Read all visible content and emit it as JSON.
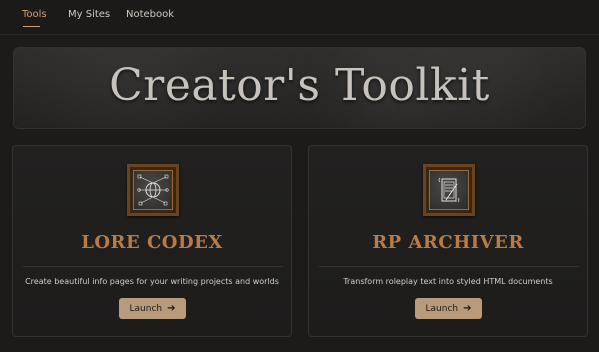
{
  "nav": {
    "items": [
      {
        "label": "Tools",
        "active": true
      },
      {
        "label": "My Sites",
        "active": false
      },
      {
        "label": "Notebook",
        "active": false
      }
    ]
  },
  "hero": {
    "title": "Creator's Toolkit"
  },
  "cards": [
    {
      "icon": "globe-network-icon",
      "title": "LORE CODEX",
      "description": "Create beautiful info pages for your writing projects and worlds",
      "button_label": "Launch",
      "button_icon": "arrow-right-icon"
    },
    {
      "icon": "document-scroll-icon",
      "title": "RP ARCHIVER",
      "description": "Transform roleplay text into styled HTML documents",
      "button_label": "Launch",
      "button_icon": "arrow-right-icon"
    }
  ],
  "colors": {
    "accent": "#c9a27a",
    "card_title": "#b77b46",
    "button_bg": "#b79b7b",
    "background": "#1c1b1a"
  }
}
